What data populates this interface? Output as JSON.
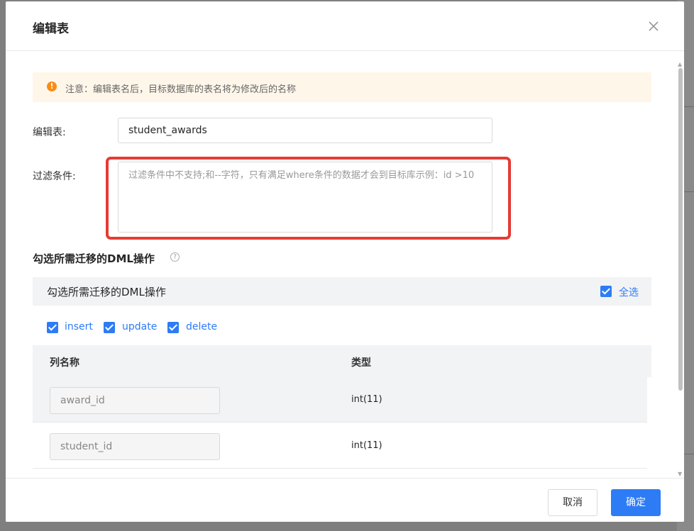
{
  "dialog": {
    "title": "编辑表",
    "close_icon": "close-icon"
  },
  "notice": {
    "icon": "warning-icon",
    "text": "注意：编辑表名后，目标数据库的表名将为修改后的名称"
  },
  "form": {
    "table_label": "编辑表:",
    "table_value": "student_awards",
    "filter_label": "过滤条件:",
    "filter_placeholder": "过滤条件中不支持;和--字符，只有满足where条件的数据才会到目标库示例：id >10"
  },
  "dml": {
    "section_title": "勾选所需迁移的DML操作",
    "help_icon": "help-icon",
    "panel_title": "勾选所需迁移的DML操作",
    "select_all_label": "全选",
    "operations": [
      {
        "label": "insert",
        "checked": true
      },
      {
        "label": "update",
        "checked": true
      },
      {
        "label": "delete",
        "checked": true
      }
    ]
  },
  "table": {
    "columns": [
      "列名称",
      "类型"
    ],
    "rows": [
      {
        "name": "award_id",
        "type": "int(11)"
      },
      {
        "name": "student_id",
        "type": "int(11)"
      }
    ]
  },
  "footer": {
    "cancel_label": "取消",
    "ok_label": "确定"
  },
  "colors": {
    "primary": "#2d7cf6",
    "warning": "#fa8c16",
    "highlight": "#e53b35"
  }
}
